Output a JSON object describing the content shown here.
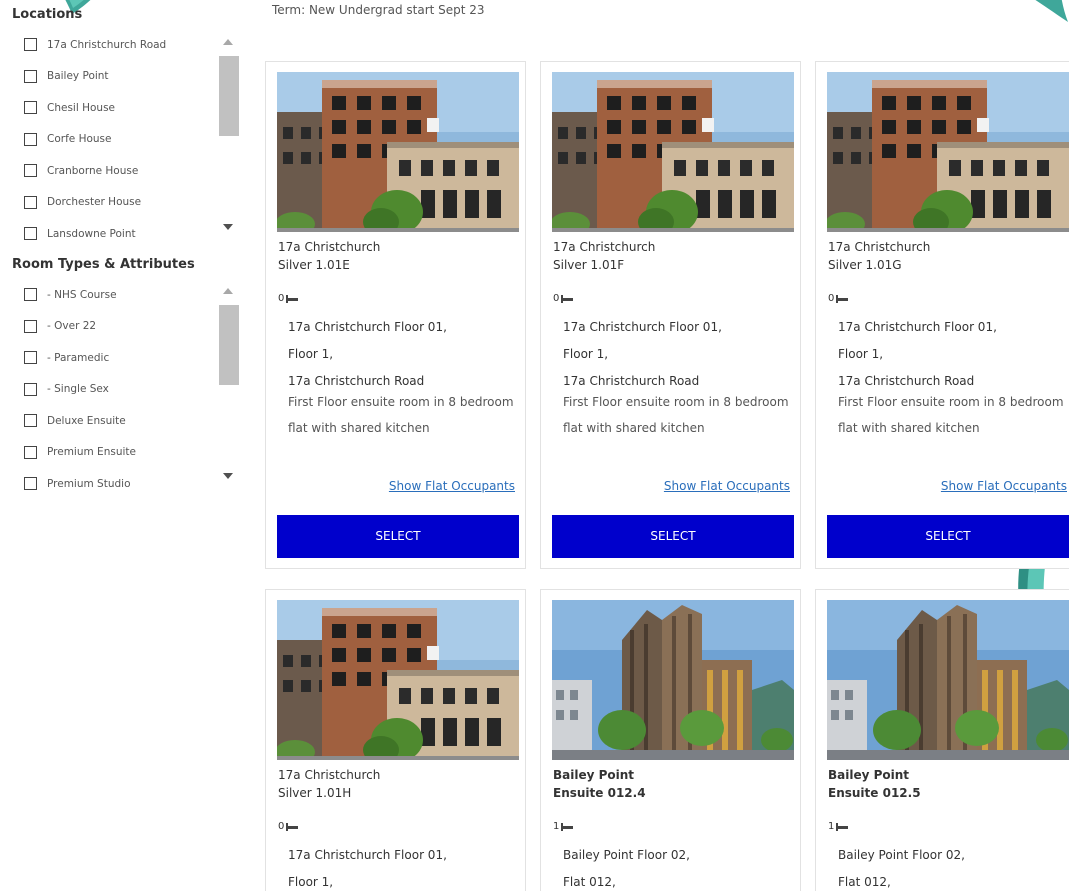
{
  "term": "Term: New Undergrad start Sept 23",
  "colors": {
    "accent": "#0000cc",
    "link": "#2a6ebb",
    "decor": "#3fa79a"
  },
  "filters": {
    "locations": {
      "title": "Locations",
      "items": [
        "17a Christchurch Road",
        "Bailey Point",
        "Chesil House",
        "Corfe House",
        "Cranborne House",
        "Dorchester House",
        "Lansdowne Point"
      ]
    },
    "room_types": {
      "title": "Room Types & Attributes",
      "items": [
        "- NHS Course",
        "- Over 22",
        "- Paramedic",
        "- Single Sex",
        "Deluxe Ensuite",
        "Premium Ensuite",
        "Premium Studio"
      ]
    }
  },
  "rooms": [
    {
      "building": "17a Christchurch",
      "room": "Silver 1.01E",
      "beds": "0",
      "floor": "17a Christchurch Floor 01,",
      "flat": "Floor 1,",
      "address": "17a Christchurch Road",
      "description": "First Floor ensuite room in 8 bedroom flat with shared kitchen",
      "occupants_label": "Show Flat Occupants",
      "select_label": "SELECT",
      "image": "christchurch-building-photo"
    },
    {
      "building": "17a Christchurch",
      "room": "Silver 1.01F",
      "beds": "0",
      "floor": "17a Christchurch Floor 01,",
      "flat": "Floor 1,",
      "address": "17a Christchurch Road",
      "description": "First Floor ensuite room in 8 bedroom flat with shared kitchen",
      "occupants_label": "Show Flat Occupants",
      "select_label": "SELECT",
      "image": "christchurch-building-photo"
    },
    {
      "building": "17a Christchurch",
      "room": "Silver 1.01G",
      "beds": "0",
      "floor": "17a Christchurch Floor 01,",
      "flat": "Floor 1,",
      "address": "17a Christchurch Road",
      "description": "First Floor ensuite room in 8 bedroom flat with shared kitchen",
      "occupants_label": "Show Flat Occupants",
      "select_label": "SELECT",
      "image": "christchurch-building-photo"
    },
    {
      "building": "17a Christchurch",
      "room": "Silver 1.01H",
      "beds": "0",
      "floor": "17a Christchurch Floor 01,",
      "flat": "Floor 1,",
      "image": "christchurch-building-photo"
    },
    {
      "building": "Bailey Point",
      "room": "Ensuite 012.4",
      "beds": "1",
      "floor": "Bailey Point Floor 02,",
      "flat": "Flat 012,",
      "image": "bailey-point-tower-photo"
    },
    {
      "building": "Bailey Point",
      "room": "Ensuite 012.5",
      "beds": "1",
      "floor": "Bailey Point Floor 02,",
      "flat": "Flat 012,",
      "image": "bailey-point-tower-photo"
    }
  ]
}
